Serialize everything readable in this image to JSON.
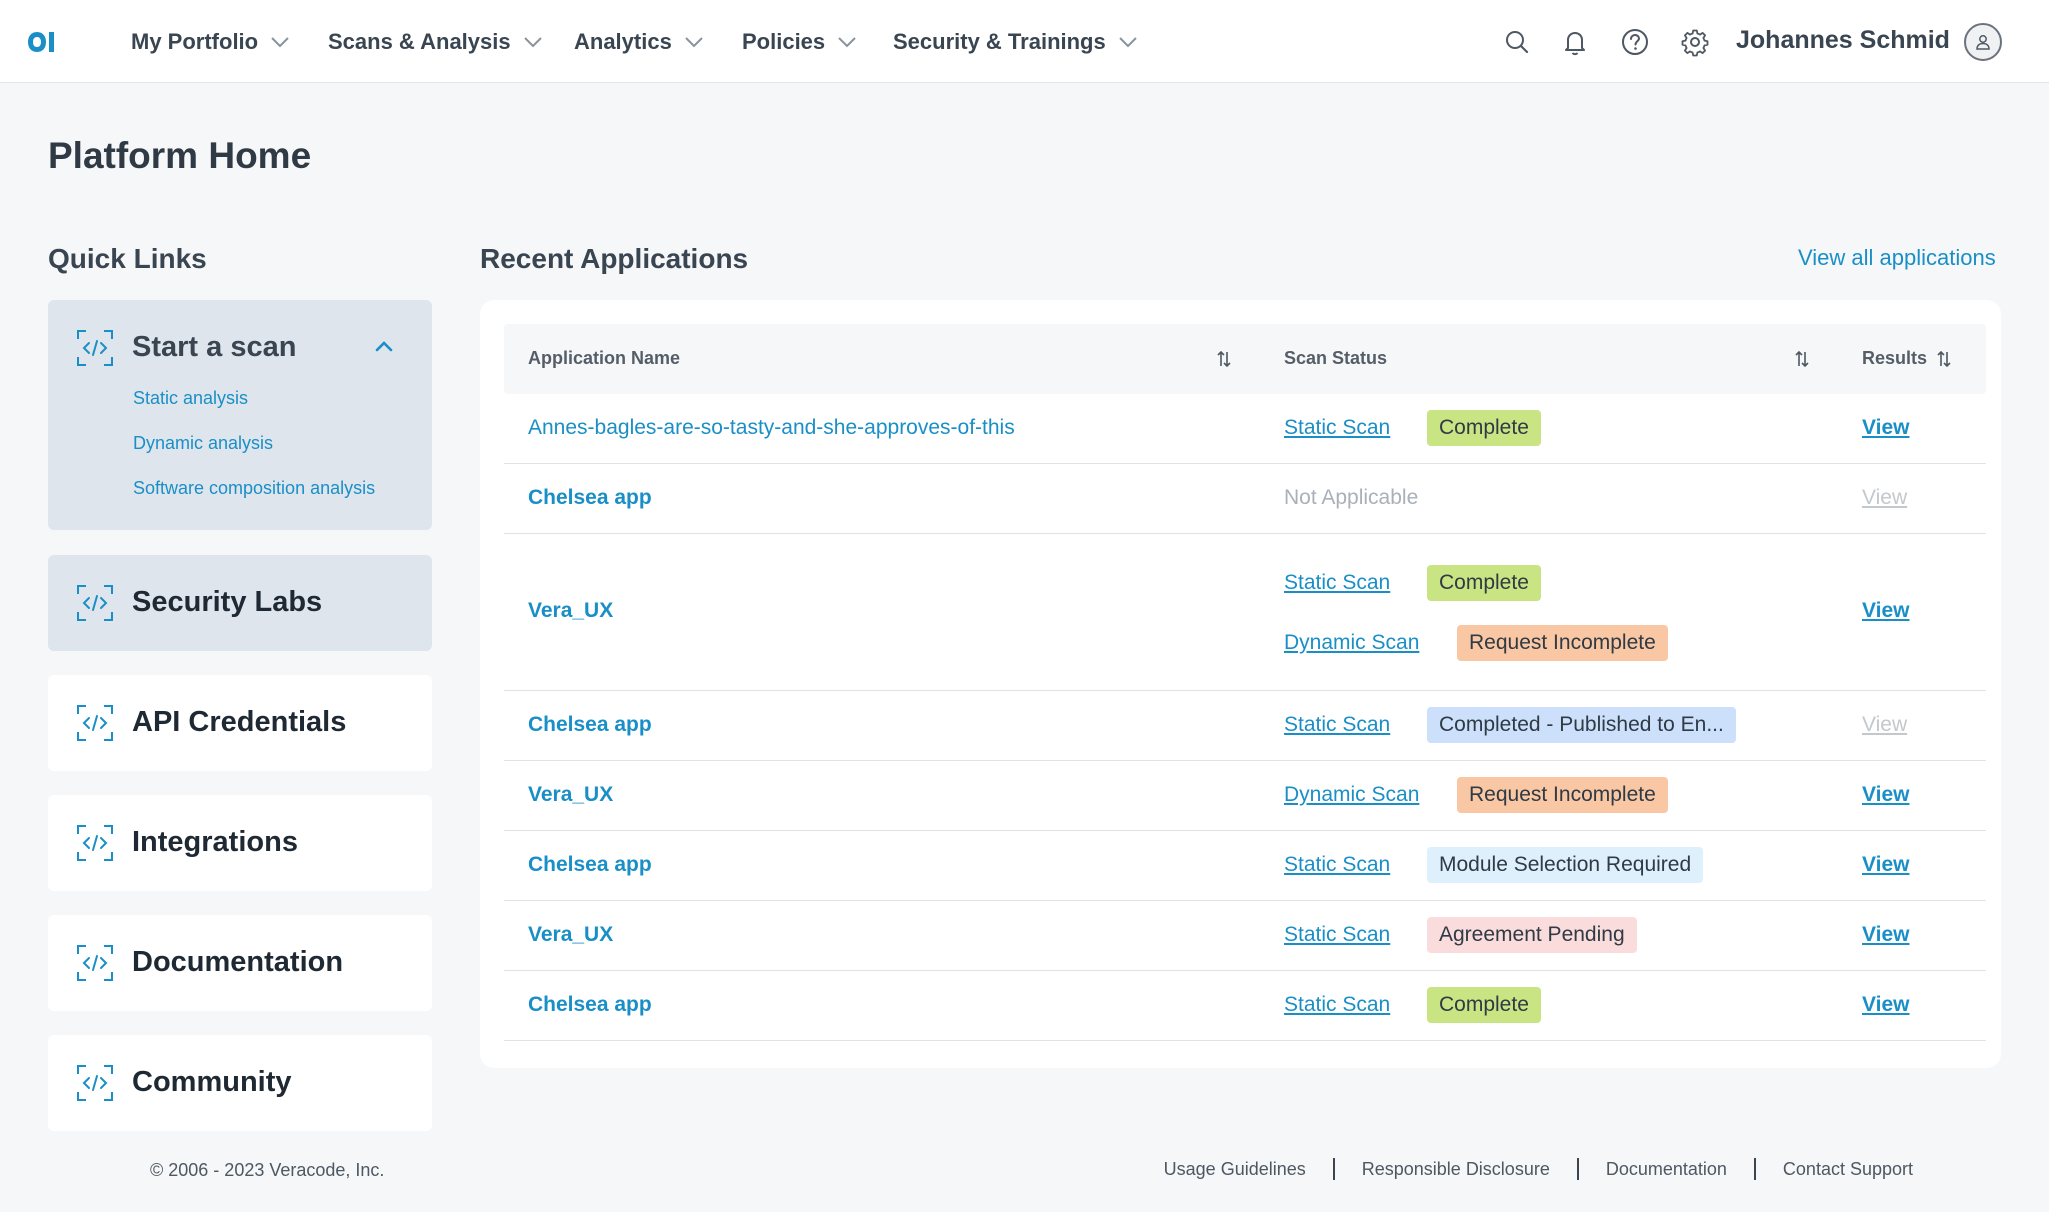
{
  "nav": {
    "items": [
      {
        "label": "My Portfolio"
      },
      {
        "label": "Scans & Analysis"
      },
      {
        "label": "Analytics"
      },
      {
        "label": "Policies"
      },
      {
        "label": "Security & Trainings"
      }
    ],
    "user_name": "Johannes Schmid",
    "icons": [
      "search-icon",
      "bell-icon",
      "help-icon",
      "gear-icon",
      "avatar-icon"
    ],
    "brand_color": "#1a8fc7"
  },
  "page": {
    "title": "Platform Home"
  },
  "quick_links": {
    "title": "Quick Links",
    "start_scan": {
      "label": "Start a scan",
      "sub_items": [
        {
          "label": "Static analysis"
        },
        {
          "label": "Dynamic analysis"
        },
        {
          "label": "Software composition analysis"
        }
      ]
    },
    "cards": [
      {
        "label": "Security Labs"
      },
      {
        "label": "API Credentials"
      },
      {
        "label": "Integrations"
      },
      {
        "label": "Documentation"
      },
      {
        "label": "Community"
      }
    ]
  },
  "recent_apps": {
    "title": "Recent Applications",
    "view_all": "View all applications",
    "columns": {
      "name": "Application Name",
      "status": "Scan Status",
      "results": "Results"
    },
    "rows": [
      {
        "name": "Annes-bagles-are-so-tasty-and-she-approves-of-this",
        "scans": [
          {
            "type": "Static Scan",
            "status": "Complete",
            "color": "#c9e483"
          }
        ],
        "result": "View",
        "result_enabled": true
      },
      {
        "name": "Chelsea app",
        "na_text": "Not Applicable",
        "result": "View",
        "result_enabled": false
      },
      {
        "name": "Vera_UX",
        "scans": [
          {
            "type": "Static Scan",
            "status": "Complete",
            "color": "#c9e483"
          },
          {
            "type": "Dynamic Scan",
            "status": "Request Incomplete",
            "color": "#f9c7a3"
          }
        ],
        "result": "View",
        "result_enabled": true
      },
      {
        "name": "Chelsea app",
        "scans": [
          {
            "type": "Static Scan",
            "status": "Completed - Published to En...",
            "color": "#cce0fb"
          }
        ],
        "result": "View",
        "result_enabled": false
      },
      {
        "name": "Vera_UX",
        "scans": [
          {
            "type": "Dynamic Scan",
            "status": "Request Incomplete",
            "color": "#f9c7a3"
          }
        ],
        "result": "View",
        "result_enabled": true
      },
      {
        "name": "Chelsea app",
        "scans": [
          {
            "type": "Static Scan",
            "status": "Module Selection Required",
            "color": "#def0fb"
          }
        ],
        "result": "View",
        "result_enabled": true
      },
      {
        "name": "Vera_UX",
        "scans": [
          {
            "type": "Static Scan",
            "status": "Agreement Pending",
            "color": "#fbdcdc"
          }
        ],
        "result": "View",
        "result_enabled": true
      },
      {
        "name": "Chelsea app",
        "scans": [
          {
            "type": "Static Scan",
            "status": "Complete",
            "color": "#c9e483"
          }
        ],
        "result": "View",
        "result_enabled": true
      }
    ]
  },
  "footer": {
    "copyright": "© 2006 - 2023 Veracode, Inc.",
    "links": [
      {
        "label": "Usage Guidelines"
      },
      {
        "label": "Responsible Disclosure"
      },
      {
        "label": "Documentation"
      },
      {
        "label": "Contact Support"
      }
    ]
  }
}
